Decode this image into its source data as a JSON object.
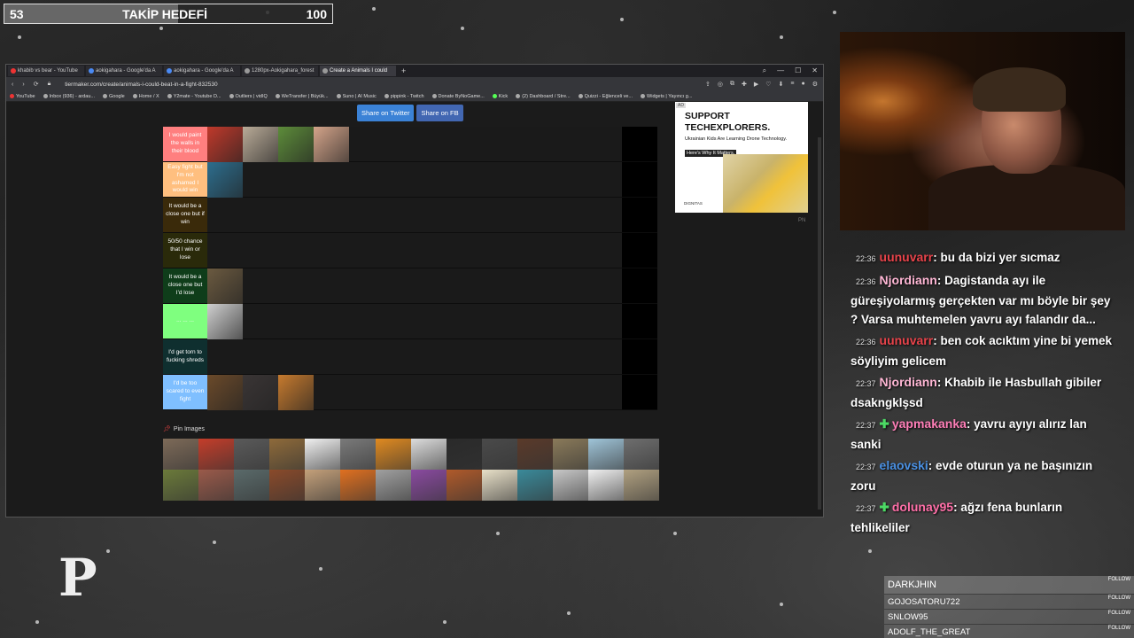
{
  "goal": {
    "current": "53",
    "title": "TAKİP HEDEFİ",
    "target": "100",
    "fraction": 0.53
  },
  "browser": {
    "tabs": [
      {
        "label": "khabib vs bear - YouTube",
        "icon": "youtube-icon"
      },
      {
        "label": "aokigahara - Google'da A",
        "icon": "google-icon"
      },
      {
        "label": "aokigahara - Google'da A",
        "icon": "google-icon"
      },
      {
        "label": "1280px-Aokigahara_forest",
        "icon": "image-icon"
      },
      {
        "label": "Create a Animals I could",
        "icon": "tiermaker-icon",
        "active": true
      }
    ],
    "url": "tiermaker.com/create/animals-i-could-beat-in-a-fight-832530",
    "bookmarks": [
      "YouTube",
      "Inbox (936) - ardau...",
      "Google",
      "Home / X",
      "Y2mate - Youtube D...",
      "Outliers | vidIQ",
      "WeTransfer | Büyük...",
      "Suno | AI Music",
      "pippink - Twitch",
      "Donate ByNoGame...",
      "Kick",
      "(2) Dashboard / Stre...",
      "Quizzi - Eğlenceli ve...",
      "Widgets | Yayıncı g..."
    ]
  },
  "share": {
    "twitter": "Share on Twitter",
    "fb": "Share on FB"
  },
  "tiers": [
    {
      "label": "I would paint the walls in their blood",
      "color": "#ff7f7f",
      "items": [
        "#c0392b",
        "#b9ab98",
        "#5d8c3a",
        "#d4a48a"
      ]
    },
    {
      "label": "Easy fight but I'm not ashamed I would win",
      "color": "#ffbf7f",
      "items": [
        "#2d6e8e"
      ]
    },
    {
      "label": "It would be a close one but if win",
      "color": "#3a2a0a",
      "items": []
    },
    {
      "label": "50/50 chance that I win or lose",
      "color": "#2a2a0a",
      "items": []
    },
    {
      "label": "It would be a close one but I'd lose",
      "color": "#0f3d1a",
      "items": [
        "#6b5a40"
      ]
    },
    {
      "label": "... ... ...",
      "color": "#7fff7f",
      "items": [
        "#cfcfcf"
      ]
    },
    {
      "label": "I'd get torn to fucking shreds",
      "color": "#0f2f2f",
      "items": []
    },
    {
      "label": "I'd be too scared to even fight",
      "color": "#7fbfff",
      "items": [
        "#6b4a2a",
        "#3a3535",
        "#c67a2e"
      ]
    }
  ],
  "pin_images": {
    "label": "Pin Images",
    "icon": "pin-icon"
  },
  "pool": [
    "#7d6a58",
    "#c43d2a",
    "#5a5a5a",
    "#8e6a3a",
    "#f0f0f0",
    "#7a7a7a",
    "#e08a20",
    "#dcdcdc",
    "#2a2a2a",
    "#4a4a4a",
    "#5a3a2a",
    "#8a7a5a",
    "#9fc4d8",
    "#6e6e6e",
    "#6b7a3a",
    "#9a5a4a",
    "#5a6a6a",
    "#8a4a2a",
    "#c4a07a",
    "#e07020",
    "#a0a0a0",
    "#8a4aa0",
    "#b05a2a",
    "#e8e0c8",
    "#3a8a9a",
    "#c8c8c8",
    "#f0f0f0",
    "#b0a080"
  ],
  "ad": {
    "tag": "AD",
    "title": "SUPPORT TECHEXPLORERS.",
    "body": "Ukrainian Kids Are Learning Drone Technology.",
    "highlight": "Here's Why It Matters.",
    "brand": "DIGNITAS",
    "pn": "PN"
  },
  "chat": [
    {
      "time": "22:36",
      "user": "uunuvarr",
      "color": "#e8434a",
      "text": ": bu da bizi yer sıcmaz",
      "badge": false
    },
    {
      "time": "22:36",
      "user": "Njordiann",
      "color": "#ffb7d5",
      "text": ": Dagistanda ayı ile güreşiyolarmış gerçekten var mı böyle bir şey ? Varsa muhtemelen yavru ayı falandır da...",
      "badge": false
    },
    {
      "time": "22:36",
      "user": "uunuvarr",
      "color": "#e8434a",
      "text": ": ben cok acıktım yine bi yemek söyliyim gelicem",
      "badge": false
    },
    {
      "time": "22:37",
      "user": "Njordiann",
      "color": "#ffb7d5",
      "text": ": Khabib ile Hasbullah gibiler dsakngklşsd",
      "badge": false
    },
    {
      "time": "22:37",
      "user": "yapmakanka",
      "color": "#ff7fb8",
      "text": ": yavru ayıyı alırız lan sanki",
      "badge": true
    },
    {
      "time": "22:37",
      "user": "elaovski",
      "color": "#4a90e2",
      "text": ": evde oturun ya ne başınızın zoru",
      "badge": false
    },
    {
      "time": "22:37",
      "user": "dolunay95",
      "color": "#ff6fa8",
      "text": ": ağzı fena bunların tehlikeliler",
      "badge": true
    }
  ],
  "followers": [
    {
      "name": "DARKJHIN",
      "tag": "FOLLOW"
    },
    {
      "name": "GOJOSATORU722",
      "tag": "FOLLOW"
    },
    {
      "name": "SNLOW95",
      "tag": "FOLLOW"
    },
    {
      "name": "ADOLF_THE_GREAT",
      "tag": "FOLLOW"
    }
  ],
  "logo": "P"
}
